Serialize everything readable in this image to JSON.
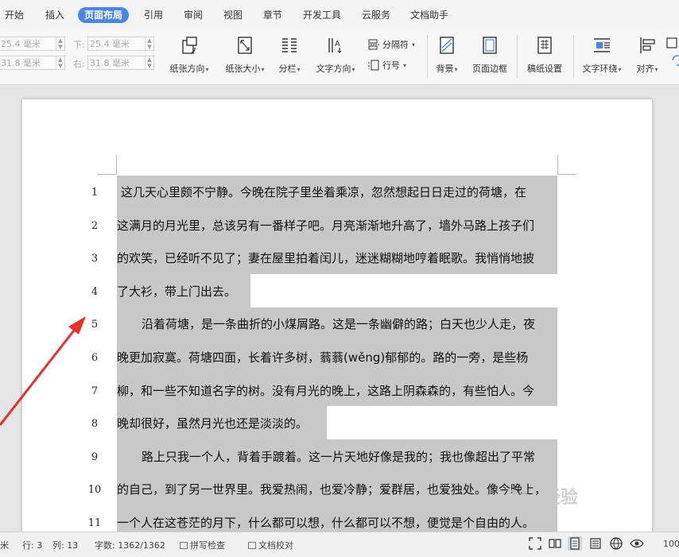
{
  "tabs": [
    "开始",
    "插入",
    "页面布局",
    "引用",
    "审阅",
    "视图",
    "章节",
    "开发工具",
    "云服务",
    "文档助手"
  ],
  "active_tab_index": 2,
  "margins": {
    "top_value": "25.4 毫米",
    "bottom_label": "下:",
    "bottom_value": "25.4 毫米",
    "left_value": "31.8 毫米",
    "right_label": "右:",
    "right_value": "31.8 毫米"
  },
  "ribbon": {
    "orientation": "纸张方向",
    "size": "纸张大小",
    "columns": "分栏",
    "text_direction": "文字方向",
    "separator": "分隔符",
    "line_number": "行号",
    "background": "背景",
    "page_border": "页面边框",
    "draft_setting": "稿纸设置",
    "text_wrap": "文字环绕",
    "align": "对齐"
  },
  "document": {
    "lines": [
      {
        "num": "1",
        "text": "这几天心里颇不宁静。今晚在院子里坐着乘凉，忽然想起日日走过的荷塘，在",
        "indent": true
      },
      {
        "num": "2",
        "text": "这满月的月光里，总该另有一番样子吧。月亮渐渐地升高了，墙外马路上孩子们",
        "indent": false
      },
      {
        "num": "3",
        "text": "的欢笑，已经听不见了；妻在屋里拍着闰儿，迷迷糊糊地哼着眠歌。我悄悄地披",
        "indent": false
      },
      {
        "num": "4",
        "text": "了大衫，带上门出去。",
        "indent": false
      },
      {
        "num": "5",
        "text": "沿着荷塘，是一条曲折的小煤屑路。这是一条幽僻的路；白天也少人走，夜",
        "indent": true
      },
      {
        "num": "6",
        "text": "晚更加寂寞。荷塘四面，长着许多树，蓊蓊(wěng)郁郁的。路的一旁，是些杨",
        "indent": false
      },
      {
        "num": "7",
        "text": "柳，和一些不知道名字的树。没有月光的晚上，这路上阴森森的，有些怕人。今",
        "indent": false
      },
      {
        "num": "8",
        "text": "晚却很好，虽然月光也还是淡淡的。",
        "indent": false
      },
      {
        "num": "9",
        "text": "路上只我一个人，背着手踱着。这一片天地好像是我的；我也像超出了平常",
        "indent": true
      },
      {
        "num": "10",
        "text": "的自己，到了另一世界里。我爱热闹，也爱冷静；爱群居，也爱独处。像今晚上，",
        "indent": false
      },
      {
        "num": "11",
        "text": "一个人在这苍茫的月下，什么都可以想，什么都可以不想，便觉是个自由的人。",
        "indent": false
      }
    ]
  },
  "watermark": "Bai 经验",
  "status": {
    "unit_fragment": "米",
    "row": "行: 3",
    "col": "列: 13",
    "word_count": "字数: 1362/1362",
    "spell_check": "拼写检查",
    "proofread": "文档校对",
    "zoom_fragment": "100"
  },
  "colors": {
    "accent": "#4a86e8",
    "highlight": "#c8c8c8",
    "arrow": "#e8302a"
  }
}
